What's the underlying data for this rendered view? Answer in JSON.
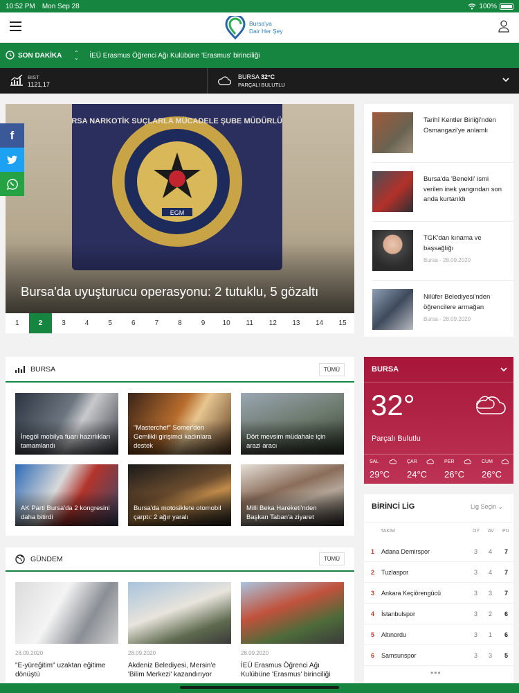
{
  "status": {
    "time": "10:52 PM",
    "date": "Mon Sep 28",
    "battery": "100%"
  },
  "header": {
    "logo_line1": "Bursa'ya",
    "logo_line2": "Dair Her Şey"
  },
  "breaking": {
    "label": "SON DAKİKA",
    "text": "İEÜ Erasmus Öğrenci Ağı Kulübüne 'Erasmus' birinciliği"
  },
  "infobar": {
    "bist_label": "BIST",
    "bist_value": "1121,17",
    "city": "BURSA",
    "temp": "32°C",
    "condition": "PARÇALI BULUTLU"
  },
  "slider": {
    "title": "Bursa'da uyuşturucu operasyonu: 2 tutuklu, 5 gözaltı",
    "plaque_text": "BURSA NARKOTİK SUÇLARLA MÜCADELE ŞUBE MÜDÜRLÜĞÜ",
    "badge_text": "EGM",
    "pages": [
      "1",
      "2",
      "3",
      "4",
      "5",
      "6",
      "7",
      "8",
      "9",
      "10",
      "11",
      "12",
      "13",
      "14",
      "15"
    ],
    "active_page": 2
  },
  "social": {
    "facebook": "f",
    "twitter": "twitter-icon",
    "whatsapp": "whatsapp-icon"
  },
  "sidelist": [
    {
      "title": "Tarihî Kentler Birliği'nden Osmangazi'ye anlamlı",
      "date": ""
    },
    {
      "title": "Bursa'da 'Benekli' ismi verilen inek yangından son anda kurtarıldı",
      "date": ""
    },
    {
      "title": "TGK'dan kınama ve başsağlığı",
      "date": "Bursa - 28.09.2020"
    },
    {
      "title": "Nilüfer Belediyesi'nden öğrencilere armağan",
      "date": "Bursa - 28.09.2020"
    }
  ],
  "bursa": {
    "title": "BURSA",
    "more": "TÜMÜ",
    "cards": [
      {
        "title": "İnegöl mobilya fuarı hazırlıkları tamamlandı"
      },
      {
        "title": "\"Masterchef\" Somer'den Gemlikli girişimci kadınlara destek"
      },
      {
        "title": "Dört mevsim müdahale için arazi aracı"
      },
      {
        "title": "AK Parti Bursa'da 2 kongresini daha bitirdi"
      },
      {
        "title": "Bursa'da motosiklete otomobil çarptı: 2 ağır yaralı"
      },
      {
        "title": "Milli Beka Hareketi'nden Başkan Taban'a ziyaret"
      }
    ]
  },
  "gundem": {
    "title": "GÜNDEM",
    "more": "TÜMÜ",
    "items": [
      {
        "date": "28.09.2020",
        "title": "\"E-yüreğitim\" uzaktan eğitime dönüştü"
      },
      {
        "date": "28.09.2020",
        "title": "Akdeniz Belediyesi, Mersin'e 'Bilim Merkezi' kazandırıyor"
      },
      {
        "date": "28.09.2020",
        "title": "İEÜ Erasmus Öğrenci Ağı Kulübüne 'Erasmus' birinciliği"
      }
    ]
  },
  "weather": {
    "city": "BURSA",
    "temp": "32°",
    "condition": "Parçalı Bulutlu",
    "days": [
      {
        "day": "SAL",
        "temp": "29°C"
      },
      {
        "day": "ÇAR",
        "temp": "24°C"
      },
      {
        "day": "PER",
        "temp": "26°C"
      },
      {
        "day": "CUM",
        "temp": "26°C"
      }
    ]
  },
  "league": {
    "title": "BİRİNCİ LİG",
    "select": "Lig Seçin",
    "cols": {
      "team": "TAKIM",
      "played": "OY",
      "av": "AV",
      "pts": "PU"
    },
    "rows": [
      {
        "rank": "1",
        "team": "Adana Demirspor",
        "played": "3",
        "av": "4",
        "pts": "7"
      },
      {
        "rank": "2",
        "team": "Tuzlaspor",
        "played": "3",
        "av": "4",
        "pts": "7"
      },
      {
        "rank": "3",
        "team": "Ankara Keçiörengücü",
        "played": "3",
        "av": "3",
        "pts": "7"
      },
      {
        "rank": "4",
        "team": "İstanbulspor",
        "played": "3",
        "av": "2",
        "pts": "6"
      },
      {
        "rank": "5",
        "team": "Altınordu",
        "played": "3",
        "av": "1",
        "pts": "6"
      },
      {
        "rank": "6",
        "team": "Samsunspor",
        "played": "3",
        "av": "3",
        "pts": "5"
      }
    ],
    "more": "•••"
  },
  "colors": {
    "green": "#15853f",
    "dark": "#1c1c1c",
    "weather": "#b02143",
    "rank": "#c0392b"
  }
}
